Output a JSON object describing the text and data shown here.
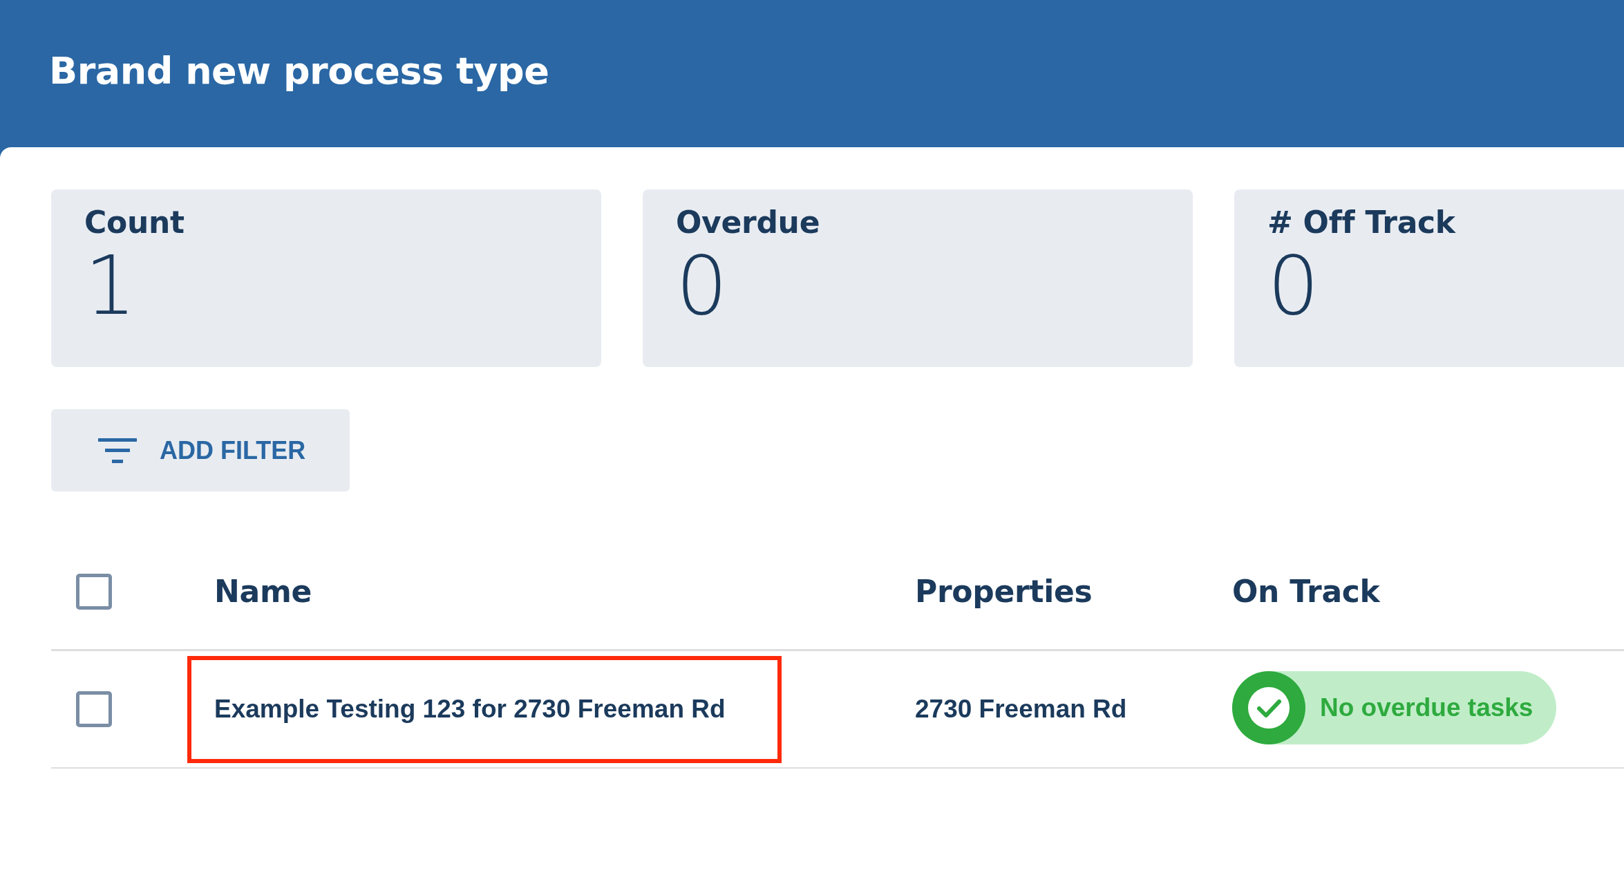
{
  "header": {
    "title": "Brand new process type"
  },
  "stats": [
    {
      "label": "Count",
      "value": "1"
    },
    {
      "label": "Overdue",
      "value": "0"
    },
    {
      "label": "# Off Track",
      "value": "0"
    }
  ],
  "filter_button": {
    "label": "ADD FILTER"
  },
  "table": {
    "select_all": {
      "checked": false
    },
    "columns": [
      "Name",
      "Properties",
      "On Track"
    ],
    "rows": [
      {
        "checked": false,
        "name": "Example Testing 123 for 2730 Freeman Rd",
        "highlighted": true,
        "properties": "2730 Freeman Rd",
        "on_track": {
          "kind": "ok",
          "label": "No overdue tasks"
        }
      }
    ]
  }
}
